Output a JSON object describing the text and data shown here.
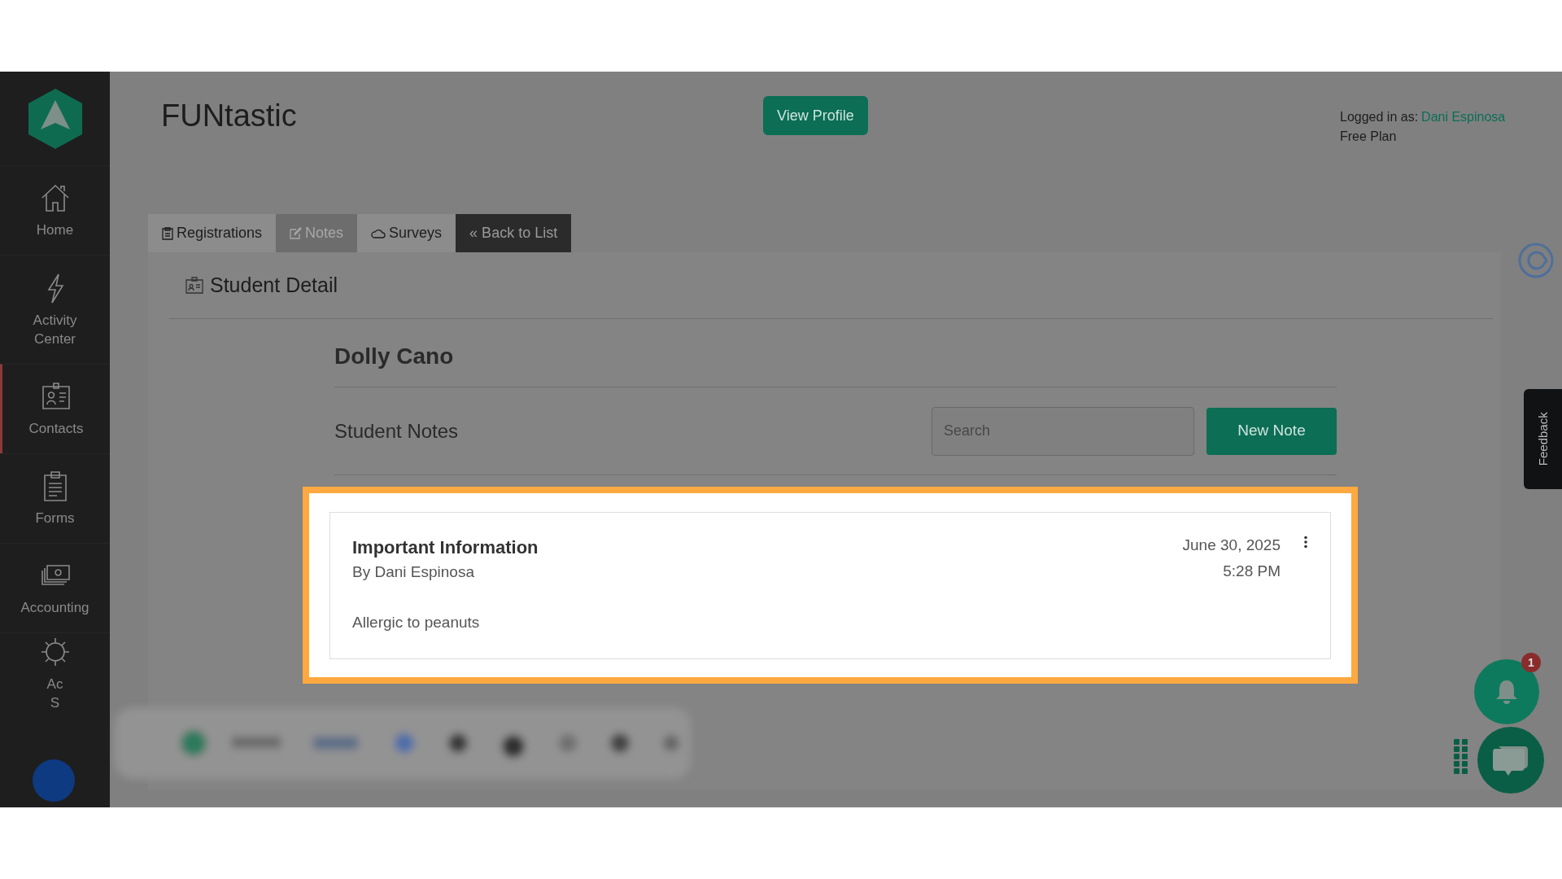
{
  "sidebar": {
    "items": [
      {
        "lines": [
          "Home"
        ],
        "selected": false
      },
      {
        "lines": [
          "Activity",
          "Center"
        ],
        "selected": false
      },
      {
        "lines": [
          "Contacts"
        ],
        "selected": true
      },
      {
        "lines": [
          "Forms"
        ],
        "selected": false
      },
      {
        "lines": [
          "Accounting"
        ],
        "selected": false
      },
      {
        "lines": [
          "Ac",
          "S"
        ],
        "selected": false
      }
    ]
  },
  "header": {
    "title": "FUNtastic",
    "profile_button": "View Profile",
    "login_prefix": "Logged in as:",
    "login_user": "Dani Espinosa",
    "plan": "Free Plan"
  },
  "tabs": [
    {
      "label": "Registrations",
      "selected": false,
      "kind": "tab"
    },
    {
      "label": "Notes",
      "selected": true,
      "kind": "tab"
    },
    {
      "label": "Surveys",
      "selected": false,
      "kind": "tab"
    },
    {
      "label": "« Back to List",
      "selected": false,
      "kind": "back"
    }
  ],
  "section_title": "Student Detail",
  "student_name": "Dolly Cano",
  "notes_heading": "Student Notes",
  "search": {
    "placeholder": "Search"
  },
  "new_note_button": "New Note",
  "notes": [
    {
      "title": "Important Information",
      "author": "By Dani Espinosa",
      "date": "June 30, 2025",
      "time": "5:28 PM",
      "body": "Allergic to peanuts",
      "highlighted": true
    }
  ],
  "notification_count": "1",
  "feedback": "Feedback"
}
